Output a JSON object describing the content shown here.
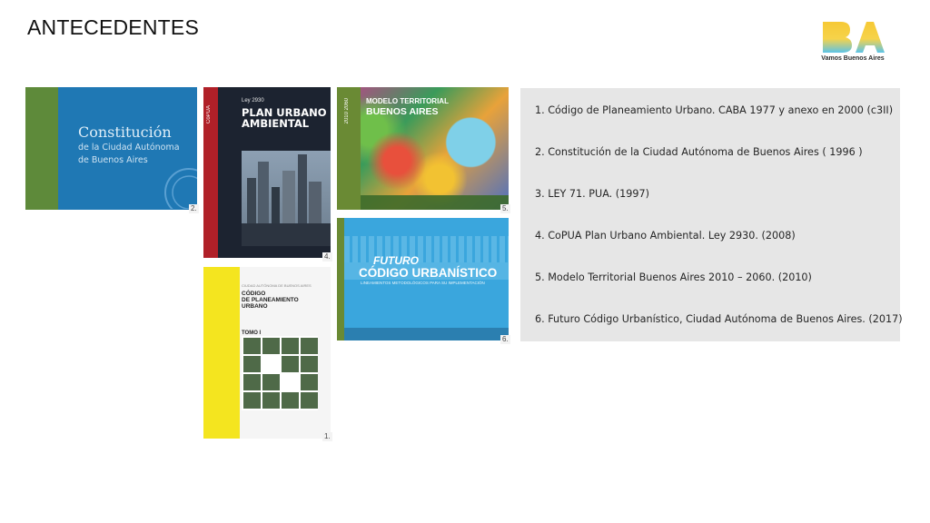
{
  "page": {
    "title": "ANTECEDENTES"
  },
  "logo": {
    "mark": "BA",
    "tagline": "Vamos Buenos Aires"
  },
  "covers": {
    "constitucion": {
      "title": "Constitución",
      "subtitle_1": "de la Ciudad Autónoma",
      "subtitle_2": "de Buenos Aires",
      "number": "2."
    },
    "copua": {
      "spine": "CoPUA",
      "law": "Ley 2930",
      "title_1": "PLAN URBANO",
      "title_2": "AMBIENTAL",
      "number": "4."
    },
    "modelo": {
      "years": "2010 2060",
      "title_1": "MODELO TERRITORIAL",
      "title_2": "BUENOS AIRES",
      "number": "5."
    },
    "futuro": {
      "title_1": "FUTURO",
      "title_2": "CÓDIGO URBANÍSTICO",
      "subtitle": "LINEAMIENTOS METODOLÓGICOS PARA SU IMPLEMENTACIÓN",
      "number": "6."
    },
    "codigo": {
      "header": "CIUDAD AUTÓNOMA DE BUENOS AIRES",
      "title_1": "CÓDIGO",
      "title_2": "DE PLANEAMIENTO",
      "title_3": "URBANO",
      "volume": "TOMO I",
      "number": "1."
    }
  },
  "list": {
    "items": [
      "1. Código de Planeamiento Urbano. CABA 1977 y anexo en 2000 (c3II)",
      "2. Constitución de la Ciudad Autónoma  de Buenos Aires ( 1996 )",
      "3. LEY 71. PUA. (1997)",
      "4. CoPUA Plan Urbano Ambiental. Ley 2930. (2008)",
      "5. Modelo Territorial Buenos Aires 2010 – 2060. (2010)",
      "6. Futuro Código Urbanístico, Ciudad Autónoma de Buenos Aires. (2017)"
    ]
  },
  "colors": {
    "panel_bg": "#e6e6e6",
    "logo_yellow": "#f6c935",
    "logo_blue": "#5cc4e8"
  }
}
